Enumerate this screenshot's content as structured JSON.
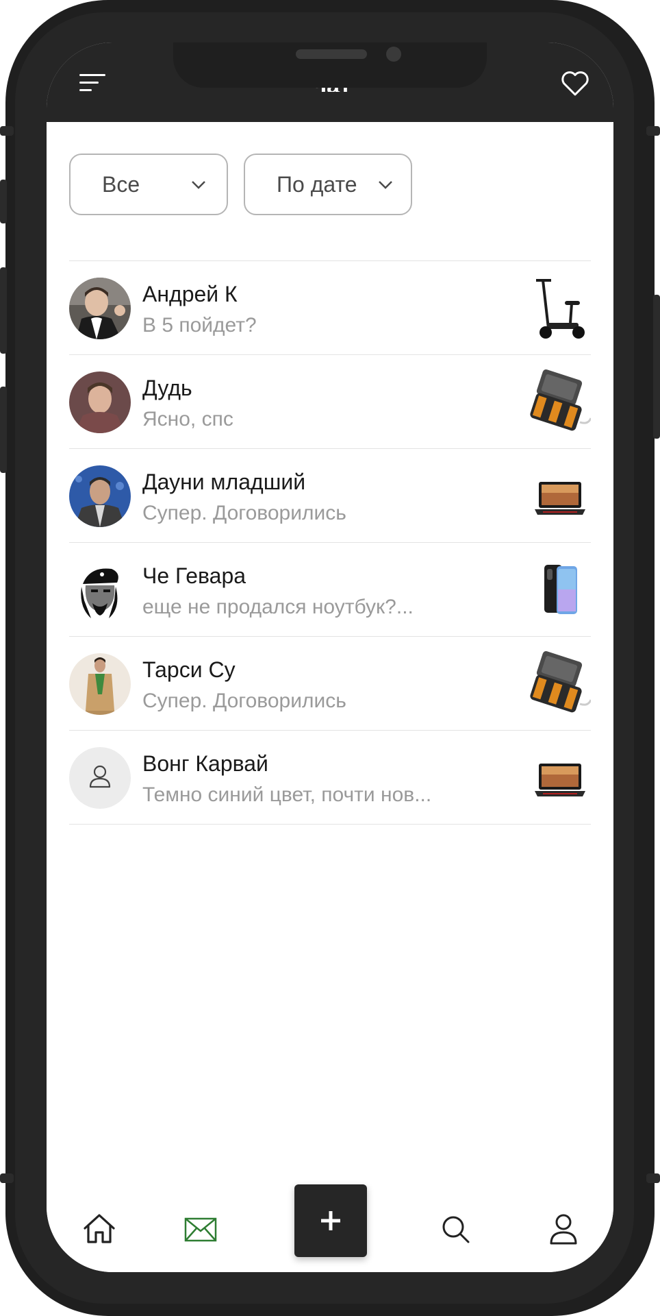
{
  "header": {
    "title": "Чат",
    "menu_icon": "menu-icon",
    "heart_icon": "heart-icon"
  },
  "filters": [
    {
      "label": "Все",
      "icon": "chevron-down-icon"
    },
    {
      "label": "По дате",
      "icon": "chevron-down-icon"
    }
  ],
  "chats": [
    {
      "name": "Андрей К",
      "message": "В 5 пойдет?",
      "avatar": "avatar-photo",
      "product": "electric-scooter"
    },
    {
      "name": "Дудь",
      "message": "Ясно, спс",
      "avatar": "avatar-photo",
      "product": "power-bank"
    },
    {
      "name": "Дауни младший",
      "message": "Супер. Договорились",
      "avatar": "avatar-photo",
      "product": "laptop"
    },
    {
      "name": "Че Гевара",
      "message": "еще не продался ноутбук?...",
      "avatar": "avatar-photo",
      "product": "smartphone"
    },
    {
      "name": "Тарси Су",
      "message": "Супер. Договорились",
      "avatar": "avatar-photo",
      "product": "power-bank"
    },
    {
      "name": "Вонг Карвай",
      "message": "Темно синий цвет, почти нов...",
      "avatar": "default-user-icon",
      "product": "laptop"
    }
  ],
  "tabbar": {
    "items": [
      "home-icon",
      "mail-icon",
      "plus-icon",
      "search-icon",
      "profile-icon"
    ],
    "active": "mail-icon",
    "active_color": "#2e7d32"
  },
  "colors": {
    "header_bg": "#262626",
    "text_primary": "#1a1a1a",
    "text_secondary": "#9a9a9a",
    "accent": "#2e7d32"
  }
}
